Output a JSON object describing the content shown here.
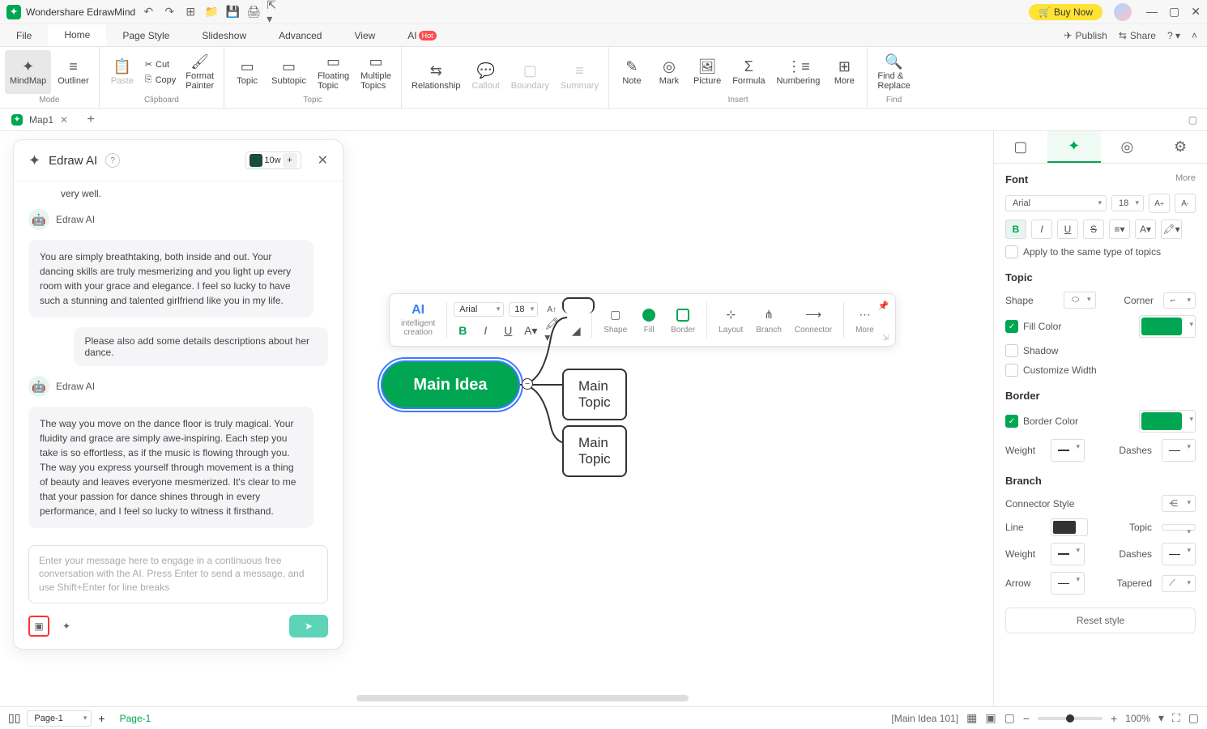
{
  "titlebar": {
    "app_name": "Wondershare EdrawMind",
    "buy_now_label": "Buy Now"
  },
  "menubar": {
    "items": [
      "File",
      "Home",
      "Page Style",
      "Slideshow",
      "Advanced",
      "View",
      "AI"
    ],
    "active_index": 1,
    "ai_badge": "Hot",
    "publish_label": "Publish",
    "share_label": "Share"
  },
  "ribbon": {
    "mode_group": "Mode",
    "mindmap": "MindMap",
    "outliner": "Outliner",
    "clipboard_group": "Clipboard",
    "paste": "Paste",
    "cut": "Cut",
    "copy": "Copy",
    "format_painter": "Format\nPainter",
    "topic_group": "Topic",
    "topic": "Topic",
    "subtopic": "Subtopic",
    "floating_topic": "Floating\nTopic",
    "multiple_topics": "Multiple\nTopics",
    "relationship": "Relationship",
    "callout": "Callout",
    "boundary": "Boundary",
    "summary": "Summary",
    "insert_group": "Insert",
    "note": "Note",
    "mark": "Mark",
    "picture": "Picture",
    "formula": "Formula",
    "numbering": "Numbering",
    "more": "More",
    "find_group": "Find",
    "find_replace": "Find &\nReplace"
  },
  "doc_tabs": {
    "tab1_label": "Map1"
  },
  "ai_panel": {
    "title": "Edraw AI",
    "credits": "10w",
    "truncated_msg": "very well.",
    "bot_name": "Edraw AI",
    "bot_msg1": "You are simply breathtaking, both inside and out. Your dancing skills are truly mesmerizing and you light up every room with your grace and elegance. I feel so lucky to have such a stunning and talented girlfriend like you in my life.",
    "user_msg2": "Please also add some details descriptions about her dance.",
    "bot_msg2": "The way you move on the dance floor is truly magical. Your fluidity and grace are simply awe-inspiring. Each step you take is so effortless, as if the music is flowing through you. The way you express yourself through movement is a thing of beauty and leaves everyone mesmerized. It's clear to me that your passion for dance shines through in every performance, and I feel so lucky to witness it firsthand.",
    "input_placeholder": "Enter your message here to engage in a continuous free conversation with the AI. Press Enter to send a message, and use Shift+Enter for line breaks"
  },
  "mindmap_data": {
    "main_idea": "Main Idea",
    "topic1": "Main Topic",
    "topic2": "Main Topic"
  },
  "float_toolbar": {
    "ai_label": "intelligent\ncreation",
    "font_family": "Arial",
    "font_size": "18",
    "shape_label": "Shape",
    "fill_label": "Fill",
    "border_label": "Border",
    "layout_label": "Layout",
    "branch_label": "Branch",
    "connector_label": "Connector",
    "more_label": "More"
  },
  "right_panel": {
    "font_section": "Font",
    "more_label": "More",
    "font_family": "Arial",
    "font_size": "18",
    "apply_same_type": "Apply to the same type of topics",
    "topic_section": "Topic",
    "shape_label": "Shape",
    "corner_label": "Corner",
    "fill_color_label": "Fill Color",
    "fill_color_value": "#00a651",
    "shadow_label": "Shadow",
    "customize_width_label": "Customize Width",
    "border_section": "Border",
    "border_color_label": "Border Color",
    "border_color_value": "#00a651",
    "weight_label": "Weight",
    "dashes_label": "Dashes",
    "branch_section": "Branch",
    "connector_style_label": "Connector Style",
    "line_label": "Line",
    "line_color": "#333333",
    "topic_label": "Topic",
    "arrow_label": "Arrow",
    "tapered_label": "Tapered",
    "reset_label": "Reset style"
  },
  "statusbar": {
    "page_select": "Page-1",
    "page_tab": "Page-1",
    "selection_info": "[Main Idea 101]",
    "zoom_value": "100%"
  }
}
